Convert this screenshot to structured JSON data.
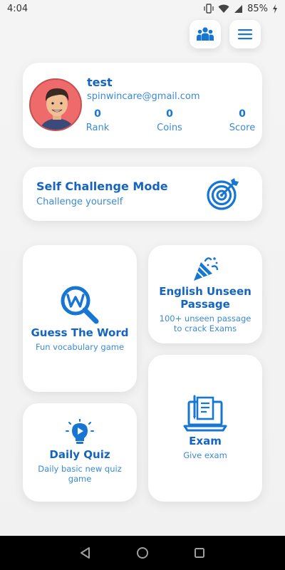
{
  "status_bar": {
    "time": "4:04",
    "battery": "85%"
  },
  "profile": {
    "name": "test",
    "email": "spinwincare@gmail.com",
    "stats": {
      "rank_value": "0",
      "rank_label": "Rank",
      "coins_value": "0",
      "coins_label": "Coins",
      "score_value": "0",
      "score_label": "Score"
    }
  },
  "challenge": {
    "title": "Self Challenge Mode",
    "subtitle": "Challenge yourself"
  },
  "tiles": {
    "guess": {
      "title": "Guess The Word",
      "subtitle": "Fun vocabulary game"
    },
    "passage": {
      "title": "English Unseen Passage",
      "subtitle": "100+ unseen passage to crack Exams"
    },
    "quiz": {
      "title": "Daily Quiz",
      "subtitle": "Daily basic new quiz game"
    },
    "exam": {
      "title": "Exam",
      "subtitle": "Give exam"
    }
  },
  "colors": {
    "accent": "#1676d2",
    "accent_light": "#3a8ad6",
    "background": "#f2f2f2"
  },
  "icons": {
    "team": "team-icon",
    "menu": "menu-icon",
    "target": "target-icon",
    "magnifier": "magnifier-w-icon",
    "party": "party-popper-icon",
    "bulb": "lightbulb-play-icon",
    "laptop": "laptop-document-icon"
  }
}
